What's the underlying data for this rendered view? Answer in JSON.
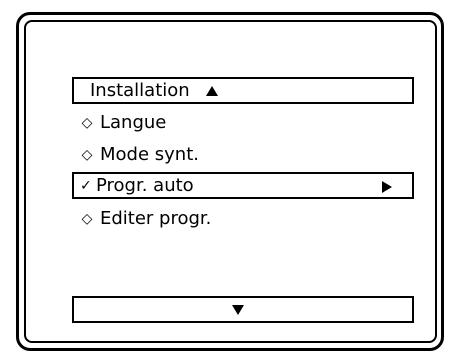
{
  "menu": {
    "title": "Installation",
    "items": [
      {
        "label": "Langue",
        "marker": "◇",
        "selected": false
      },
      {
        "label": "Mode synt.",
        "marker": "◇",
        "selected": false
      },
      {
        "label": "Progr. auto",
        "marker": "✓",
        "selected": true
      },
      {
        "label": "Editer progr.",
        "marker": "◇",
        "selected": false
      }
    ]
  },
  "icons": {
    "scroll_up": "up-arrow-icon",
    "scroll_down": "down-arrow-icon",
    "submenu": "right-arrow-icon"
  },
  "colors": {
    "foreground": "#000000",
    "background": "#ffffff"
  }
}
